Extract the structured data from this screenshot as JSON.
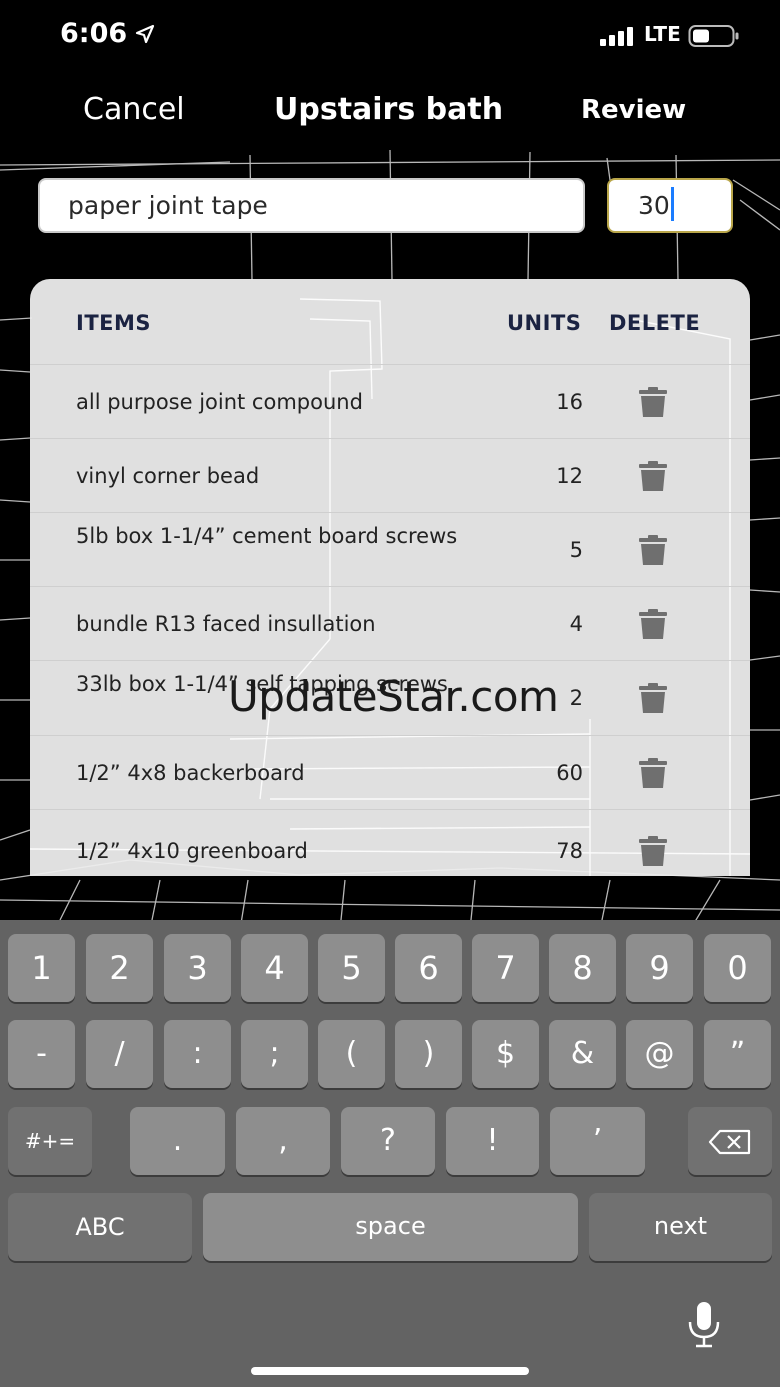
{
  "status": {
    "time": "6:06",
    "network": "LTE"
  },
  "nav": {
    "cancel": "Cancel",
    "title": "Upstairs bath",
    "review": "Review"
  },
  "form": {
    "item_value": "paper joint tape",
    "qty_value": "30"
  },
  "table": {
    "headers": {
      "items": "ITEMS",
      "units": "UNITS",
      "delete": "DELETE"
    },
    "rows": [
      {
        "name": "all purpose joint compound",
        "units": "16"
      },
      {
        "name": "vinyl corner bead",
        "units": "12"
      },
      {
        "name": "5lb box 1-1/4” cement board screws",
        "units": "5"
      },
      {
        "name": "bundle R13 faced insullation",
        "units": "4"
      },
      {
        "name": "33lb box 1-1/4” self tapping screws",
        "units": "2"
      },
      {
        "name": "1/2” 4x8 backerboard",
        "units": "60"
      },
      {
        "name": "1/2” 4x10 greenboard",
        "units": "78"
      }
    ]
  },
  "watermark": "UpdateStar.com",
  "keyboard": {
    "row1": [
      "1",
      "2",
      "3",
      "4",
      "5",
      "6",
      "7",
      "8",
      "9",
      "0"
    ],
    "row2": [
      "-",
      "/",
      ":",
      ";",
      "(",
      ")",
      "$",
      "&",
      "@",
      "”"
    ],
    "row3": [
      ".",
      ",",
      "?",
      "!",
      "’"
    ],
    "symbols_key": "#+=",
    "abc_key": "ABC",
    "space_key": "space",
    "next_key": "next"
  },
  "icons": {
    "delete": "trash-icon",
    "backspace": "backspace-icon",
    "dictation": "microphone-icon",
    "location": "location-arrow-icon"
  }
}
